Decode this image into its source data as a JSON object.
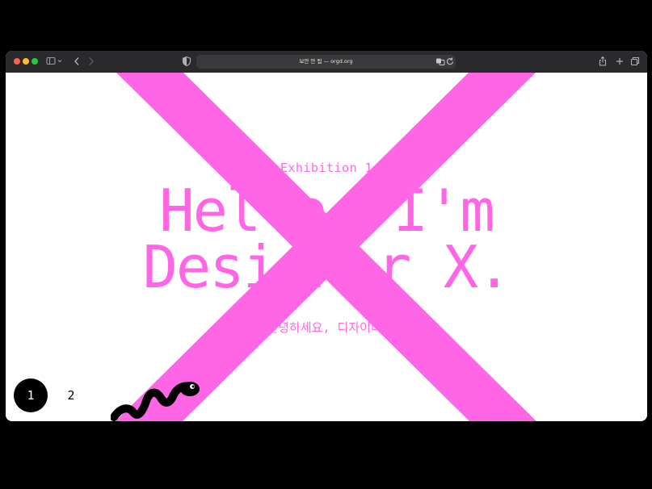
{
  "browser": {
    "address": "보안 안 됨 — orgd.org",
    "icons": {
      "sidebar": "sidebar-icon",
      "back": "chevron-left-icon",
      "forward": "chevron-right-icon",
      "shield": "shield-icon",
      "translate": "translate-icon",
      "reload": "reload-icon",
      "share": "share-icon",
      "new_tab": "plus-icon",
      "tabs": "tab-overview-icon"
    }
  },
  "page": {
    "eyebrow": "Exhibition 1",
    "headline_line1": "Hello, I'm",
    "headline_line2": "Designer X.",
    "subtitle": "전시 1: 안녕하세요, 디자이너 X입니다.",
    "pagination": [
      "1",
      "2"
    ],
    "active_page": "1"
  },
  "colors": {
    "accent": "#ff66e5",
    "toolbar": "#2a2a2c",
    "background": "#ffffff",
    "active_page_bg": "#000000"
  }
}
